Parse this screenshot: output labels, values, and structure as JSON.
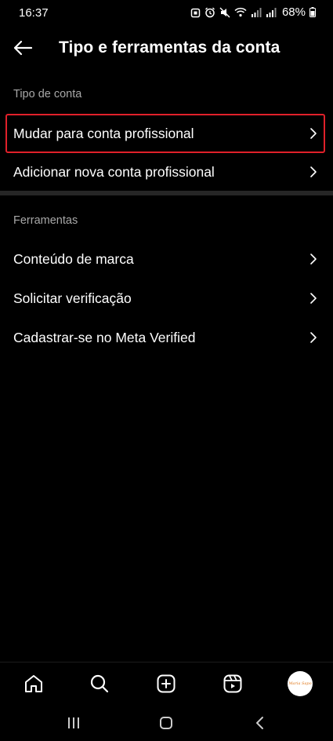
{
  "status_bar": {
    "time": "16:37",
    "battery": "68%",
    "icons": [
      "clock-alarm-icon",
      "mute-icon",
      "wifi-icon",
      "signal-icon",
      "signal-icon",
      "battery-icon"
    ]
  },
  "header": {
    "title": "Tipo e ferramentas da conta",
    "back_icon": "arrow-left-icon"
  },
  "sections": {
    "account_type": {
      "label": "Tipo de conta",
      "items": [
        {
          "label": "Mudar para conta profissional",
          "highlighted": true
        },
        {
          "label": "Adicionar nova conta profissional"
        }
      ]
    },
    "tools": {
      "label": "Ferramentas",
      "items": [
        {
          "label": "Conteúdo de marca"
        },
        {
          "label": "Solicitar verificação"
        },
        {
          "label": "Cadastrar-se no Meta Verified"
        }
      ]
    }
  },
  "bottom_nav": {
    "items": [
      "home-icon",
      "search-icon",
      "create-post-icon",
      "reels-icon",
      "profile-avatar"
    ],
    "avatar_text": "Maria Sapo"
  },
  "system_nav": {
    "items": [
      "recent-apps-icon",
      "home-circle-icon",
      "back-chevron-icon"
    ]
  },
  "colors": {
    "background": "#000000",
    "highlight_border": "#e0202a",
    "secondary_text": "#a8a8a8",
    "divider": "#262626"
  }
}
